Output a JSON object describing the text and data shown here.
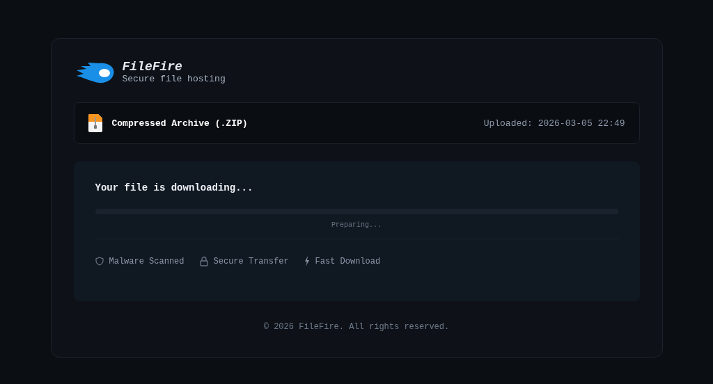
{
  "brand": {
    "name": "FileFire",
    "tagline": "Secure file hosting"
  },
  "file": {
    "type": "Compressed Archive (.ZIP)",
    "uploaded": "Uploaded: 2026-03-05 22:49"
  },
  "download": {
    "status": "Your file is downloading...",
    "level": 0,
    "progress_label": "Preparing..."
  },
  "features": [
    {
      "kind": "shield",
      "label": "Malware Scanned"
    },
    {
      "kind": "lock",
      "label": "Secure Transfer"
    },
    {
      "kind": "bolt",
      "label": "Fast Download"
    }
  ],
  "footer": "© 2026 FileFire. All rights reserved."
}
